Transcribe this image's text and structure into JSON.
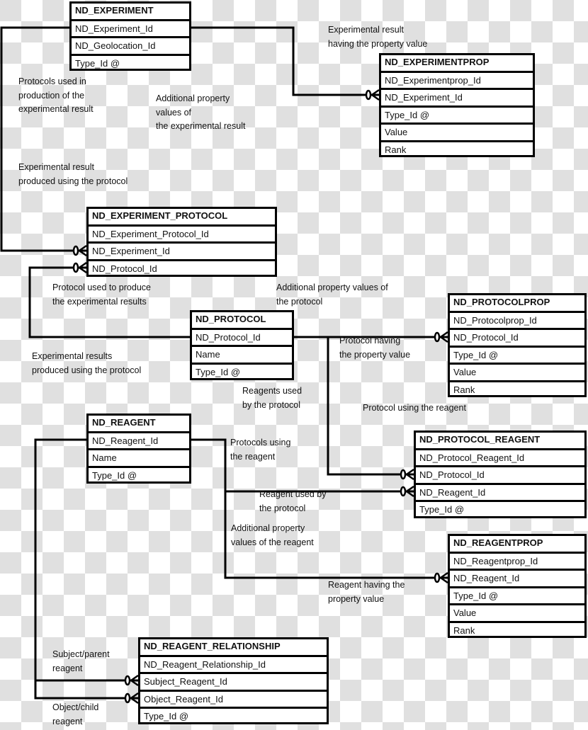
{
  "entities": {
    "experiment": {
      "title": "ND_EXPERIMENT",
      "fields": [
        "ND_Experiment_Id",
        "ND_Geolocation_Id",
        "Type_Id @"
      ]
    },
    "experimentprop": {
      "title": "ND_EXPERIMENTPROP",
      "fields": [
        "ND_Experimentprop_Id",
        "ND_Experiment_Id",
        "Type_Id @",
        "Value",
        "Rank"
      ]
    },
    "experiment_protocol": {
      "title": "ND_EXPERIMENT_PROTOCOL",
      "fields": [
        "ND_Experiment_Protocol_Id",
        "ND_Experiment_Id",
        "ND_Protocol_Id"
      ]
    },
    "protocol": {
      "title": "ND_PROTOCOL",
      "fields": [
        "ND_Protocol_Id",
        "Name",
        "Type_Id @"
      ]
    },
    "protocolprop": {
      "title": "ND_PROTOCOLPROP",
      "fields": [
        "ND_Protocolprop_Id",
        "ND_Protocol_Id",
        "Type_Id @",
        "Value",
        "Rank"
      ]
    },
    "reagent": {
      "title": "ND_REAGENT",
      "fields": [
        "ND_Reagent_Id",
        "Name",
        "Type_Id @"
      ]
    },
    "protocol_reagent": {
      "title": "ND_PROTOCOL_REAGENT",
      "fields": [
        "ND_Protocol_Reagent_Id",
        "ND_Protocol_Id",
        "ND_Reagent_Id",
        "Type_Id @"
      ]
    },
    "reagentprop": {
      "title": "ND_REAGENTPROP",
      "fields": [
        "ND_Reagentprop_Id",
        "ND_Reagent_Id",
        "Type_Id @",
        "Value",
        "Rank"
      ]
    },
    "reagent_relationship": {
      "title": "ND_REAGENT_RELATIONSHIP",
      "fields": [
        "ND_Reagent_Relationship_Id",
        "Subject_Reagent_Id",
        "Object_Reagent_Id",
        "Type_Id @"
      ]
    }
  },
  "labels": {
    "exp_result_having_prop": "Experimental result\nhaving the property value",
    "protocols_used_in_production": "Protocols used in\nproduction of the\nexperimental result",
    "additional_prop_exp": "Additional property\nvalues of\nthe experimental result",
    "exp_result_produced_using_protocol": "Experimental result\nproduced using the protocol",
    "protocol_used_to_produce": "Protocol used to produce\nthe experimental results",
    "additional_prop_protocol": "Additional property values of\nthe protocol",
    "exp_results_produced_using_protocol": "Experimental results\nproduced using the protocol",
    "protocol_having_prop": "Protocol having\nthe property value",
    "reagents_used_by_protocol": "Reagents used\nby the protocol",
    "protocol_using_reagent": "Protocol using the reagent",
    "protocols_using_reagent": "Protocols using\nthe reagent",
    "reagent_used_by_protocol": "Reagent used by\nthe protocol",
    "additional_prop_reagent": "Additional property\nvalues of the reagent",
    "reagent_having_prop": "Reagent having the\nproperty value",
    "subject_parent_reagent": "Subject/parent\nreagent",
    "object_child_reagent": "Object/child\nreagent"
  },
  "relationships": [
    {
      "from": "ND_EXPERIMENT.ND_Experiment_Id",
      "to": "ND_EXPERIMENTPROP.ND_Experiment_Id",
      "cardinality": "zero-or-many"
    },
    {
      "from": "ND_EXPERIMENT.ND_Experiment_Id",
      "to": "ND_EXPERIMENT_PROTOCOL.ND_Experiment_Id",
      "cardinality": "zero-or-many"
    },
    {
      "from": "ND_PROTOCOL.ND_Protocol_Id",
      "to": "ND_EXPERIMENT_PROTOCOL.ND_Protocol_Id",
      "cardinality": "zero-or-many"
    },
    {
      "from": "ND_PROTOCOL.ND_Protocol_Id",
      "to": "ND_PROTOCOLPROP.ND_Protocol_Id",
      "cardinality": "zero-or-many"
    },
    {
      "from": "ND_PROTOCOL.ND_Protocol_Id",
      "to": "ND_PROTOCOL_REAGENT.ND_Protocol_Id",
      "cardinality": "zero-or-many"
    },
    {
      "from": "ND_REAGENT.ND_Reagent_Id",
      "to": "ND_PROTOCOL_REAGENT.ND_Reagent_Id",
      "cardinality": "zero-or-many"
    },
    {
      "from": "ND_REAGENT.ND_Reagent_Id",
      "to": "ND_REAGENTPROP.ND_Reagent_Id",
      "cardinality": "zero-or-many"
    },
    {
      "from": "ND_REAGENT.ND_Reagent_Id",
      "to": "ND_REAGENT_RELATIONSHIP.Subject_Reagent_Id",
      "cardinality": "zero-or-many"
    },
    {
      "from": "ND_REAGENT.ND_Reagent_Id",
      "to": "ND_REAGENT_RELATIONSHIP.Object_Reagent_Id",
      "cardinality": "zero-or-many"
    }
  ]
}
